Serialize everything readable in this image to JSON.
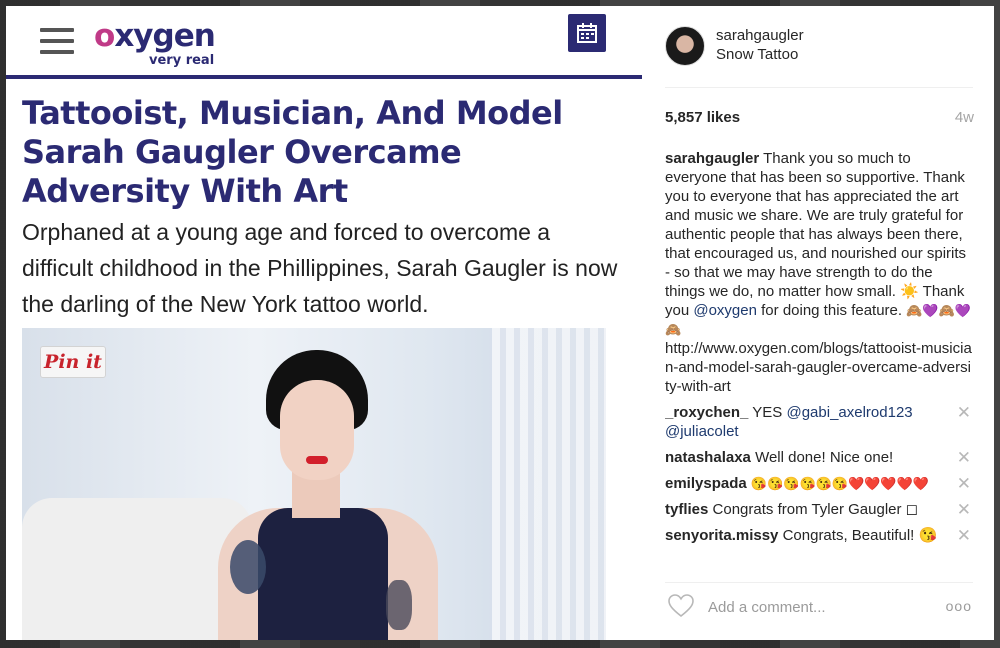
{
  "article": {
    "logo_text": "oxygen",
    "logo_tagline": "very real",
    "title": "Tattooist, Musician, And Model Sarah Gaugler Overcame Adversity With Art",
    "subtitle": "Orphaned at a young age and forced to overcome a difficult childhood in the Phillippines, Sarah Gaugler is now the darling of the New York tattoo world.",
    "pin_label": "Pin it",
    "menu_icon": "hamburger-icon",
    "calendar_icon": "calendar-icon",
    "brand_color": "#2b2a73",
    "accent_color": "#c03a87"
  },
  "post": {
    "username": "sarahgaugler",
    "location": "Snow Tattoo",
    "likes": "5,857 likes",
    "age": "4w",
    "caption": {
      "username": "sarahgaugler",
      "text_1": "Thank you so much to everyone that has been so supportive. Thank you to everyone that has appreciated the art and music we share. We are truly grateful for authentic people that has always been there, that encouraged us, and nourished our spirits - so that we may have strength to do the things we do, no matter how small. ☀️ Thank you",
      "mention": "@oxygen",
      "text_2": "for doing this feature.",
      "emojis": "🙈💜🙈💜🙈",
      "link": "http://www.oxygen.com/blogs/tattooist-musician-and-model-sarah-gaugler-overcame-adversity-with-art"
    },
    "comments": [
      {
        "username": "_roxychen_",
        "text": "YES",
        "mention_1": "@gabi_axelrod123",
        "mention_2": "@juliacolet"
      },
      {
        "username": "natashalaxa",
        "text": "Well done! Nice one!"
      },
      {
        "username": "emilyspada",
        "text": "😘😘😘😘😘😘❤️❤️❤️❤️❤️"
      },
      {
        "username": "tyflies",
        "text": "Congrats from Tyler Gaugler ◻"
      },
      {
        "username": "senyorita.missy",
        "text": "Congrats, Beautiful! 😘"
      }
    ],
    "delete_glyph": "✕",
    "comment_placeholder": "Add a comment...",
    "more_glyph": "ooo"
  }
}
